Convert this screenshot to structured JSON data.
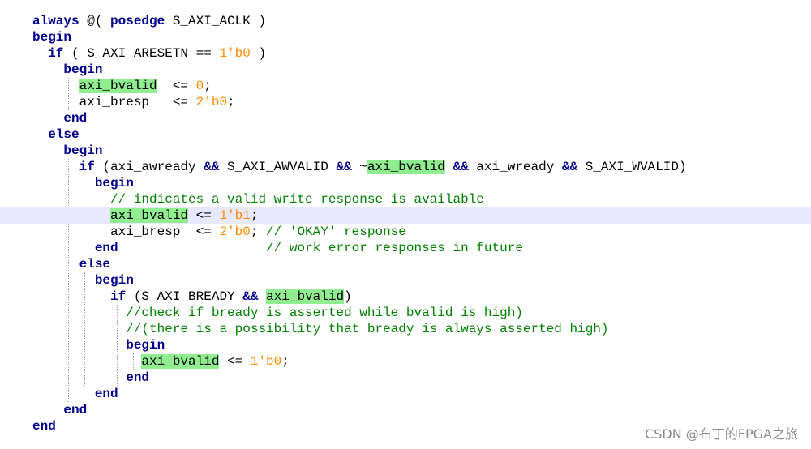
{
  "lines": [
    [
      {
        "t": "always",
        "c": "kw"
      },
      {
        "t": " @( ",
        "c": "tx"
      },
      {
        "t": "posedge",
        "c": "kw"
      },
      {
        "t": " S_AXI_ACLK )",
        "c": "tx"
      }
    ],
    [
      {
        "t": "begin",
        "c": "kw"
      }
    ],
    [
      {
        "t": "  ",
        "c": "tx"
      },
      {
        "t": "if",
        "c": "kw"
      },
      {
        "t": " ( S_AXI_ARESETN == ",
        "c": "tx"
      },
      {
        "t": "1'b0",
        "c": "num"
      },
      {
        "t": " )",
        "c": "tx"
      }
    ],
    [
      {
        "t": "    ",
        "c": "tx"
      },
      {
        "t": "begin",
        "c": "kw"
      }
    ],
    [
      {
        "t": "      ",
        "c": "tx"
      },
      {
        "t": "axi_bvalid",
        "c": "tx",
        "h": true
      },
      {
        "t": "  <= ",
        "c": "tx"
      },
      {
        "t": "0",
        "c": "num"
      },
      {
        "t": ";",
        "c": "tx"
      }
    ],
    [
      {
        "t": "      axi_bresp   <= ",
        "c": "tx"
      },
      {
        "t": "2'b0",
        "c": "num"
      },
      {
        "t": ";",
        "c": "tx"
      }
    ],
    [
      {
        "t": "    ",
        "c": "tx"
      },
      {
        "t": "end",
        "c": "kw"
      }
    ],
    [
      {
        "t": "  ",
        "c": "tx"
      },
      {
        "t": "else",
        "c": "kw"
      }
    ],
    [
      {
        "t": "    ",
        "c": "tx"
      },
      {
        "t": "begin",
        "c": "kw"
      }
    ],
    [
      {
        "t": "      ",
        "c": "tx"
      },
      {
        "t": "if",
        "c": "kw"
      },
      {
        "t": " (axi_awready ",
        "c": "tx"
      },
      {
        "t": "&&",
        "c": "kw"
      },
      {
        "t": " S_AXI_AWVALID ",
        "c": "tx"
      },
      {
        "t": "&&",
        "c": "kw"
      },
      {
        "t": " ~",
        "c": "tx"
      },
      {
        "t": "axi_bvalid",
        "c": "tx",
        "h": true
      },
      {
        "t": " ",
        "c": "tx"
      },
      {
        "t": "&&",
        "c": "kw"
      },
      {
        "t": " axi_wready ",
        "c": "tx"
      },
      {
        "t": "&&",
        "c": "kw"
      },
      {
        "t": " S_AXI_WVALID)",
        "c": "tx"
      }
    ],
    [
      {
        "t": "        ",
        "c": "tx"
      },
      {
        "t": "begin",
        "c": "kw"
      }
    ],
    [
      {
        "t": "          ",
        "c": "tx"
      },
      {
        "t": "// indicates a valid write response is available",
        "c": "cm"
      }
    ],
    [
      {
        "t": "          ",
        "c": "tx"
      },
      {
        "t": "axi_bvalid",
        "c": "tx",
        "h": true
      },
      {
        "t": " <= ",
        "c": "tx"
      },
      {
        "t": "1'b1",
        "c": "num"
      },
      {
        "t": ";",
        "c": "tx"
      }
    ],
    [
      {
        "t": "          axi_bresp  <= ",
        "c": "tx"
      },
      {
        "t": "2'b0",
        "c": "num"
      },
      {
        "t": "; ",
        "c": "tx"
      },
      {
        "t": "// 'OKAY' response",
        "c": "cm"
      }
    ],
    [
      {
        "t": "        ",
        "c": "tx"
      },
      {
        "t": "end",
        "c": "kw"
      },
      {
        "t": "                   ",
        "c": "tx"
      },
      {
        "t": "// work error responses in future",
        "c": "cm"
      }
    ],
    [
      {
        "t": "      ",
        "c": "tx"
      },
      {
        "t": "else",
        "c": "kw"
      }
    ],
    [
      {
        "t": "        ",
        "c": "tx"
      },
      {
        "t": "begin",
        "c": "kw"
      }
    ],
    [
      {
        "t": "          ",
        "c": "tx"
      },
      {
        "t": "if",
        "c": "kw"
      },
      {
        "t": " (S_AXI_BREADY ",
        "c": "tx"
      },
      {
        "t": "&&",
        "c": "kw"
      },
      {
        "t": " ",
        "c": "tx"
      },
      {
        "t": "axi_bvalid",
        "c": "tx",
        "h": true
      },
      {
        "t": ")",
        "c": "tx"
      }
    ],
    [
      {
        "t": "            ",
        "c": "tx"
      },
      {
        "t": "//check if bready is asserted while bvalid is high)",
        "c": "cm"
      }
    ],
    [
      {
        "t": "            ",
        "c": "tx"
      },
      {
        "t": "//(there is a possibility that bready is always asserted high)",
        "c": "cm"
      }
    ],
    [
      {
        "t": "            ",
        "c": "tx"
      },
      {
        "t": "begin",
        "c": "kw"
      }
    ],
    [
      {
        "t": "              ",
        "c": "tx"
      },
      {
        "t": "axi_bvalid",
        "c": "tx",
        "h": true
      },
      {
        "t": " <= ",
        "c": "tx"
      },
      {
        "t": "1'b0",
        "c": "num"
      },
      {
        "t": ";",
        "c": "tx"
      }
    ],
    [
      {
        "t": "            ",
        "c": "tx"
      },
      {
        "t": "end",
        "c": "kw"
      }
    ],
    [
      {
        "t": "        ",
        "c": "tx"
      },
      {
        "t": "end",
        "c": "kw"
      }
    ],
    [
      {
        "t": "    ",
        "c": "tx"
      },
      {
        "t": "end",
        "c": "kw"
      }
    ],
    [
      {
        "t": "end",
        "c": "kw"
      }
    ]
  ],
  "current_line_number": 13,
  "watermark": "CSDN @布丁的FPGA之旅",
  "colors": {
    "keyword": "#00008b",
    "number": "#ff8c00",
    "comment": "#008000",
    "highlight": "#90ee90",
    "current_line": "#e8e8ff"
  }
}
